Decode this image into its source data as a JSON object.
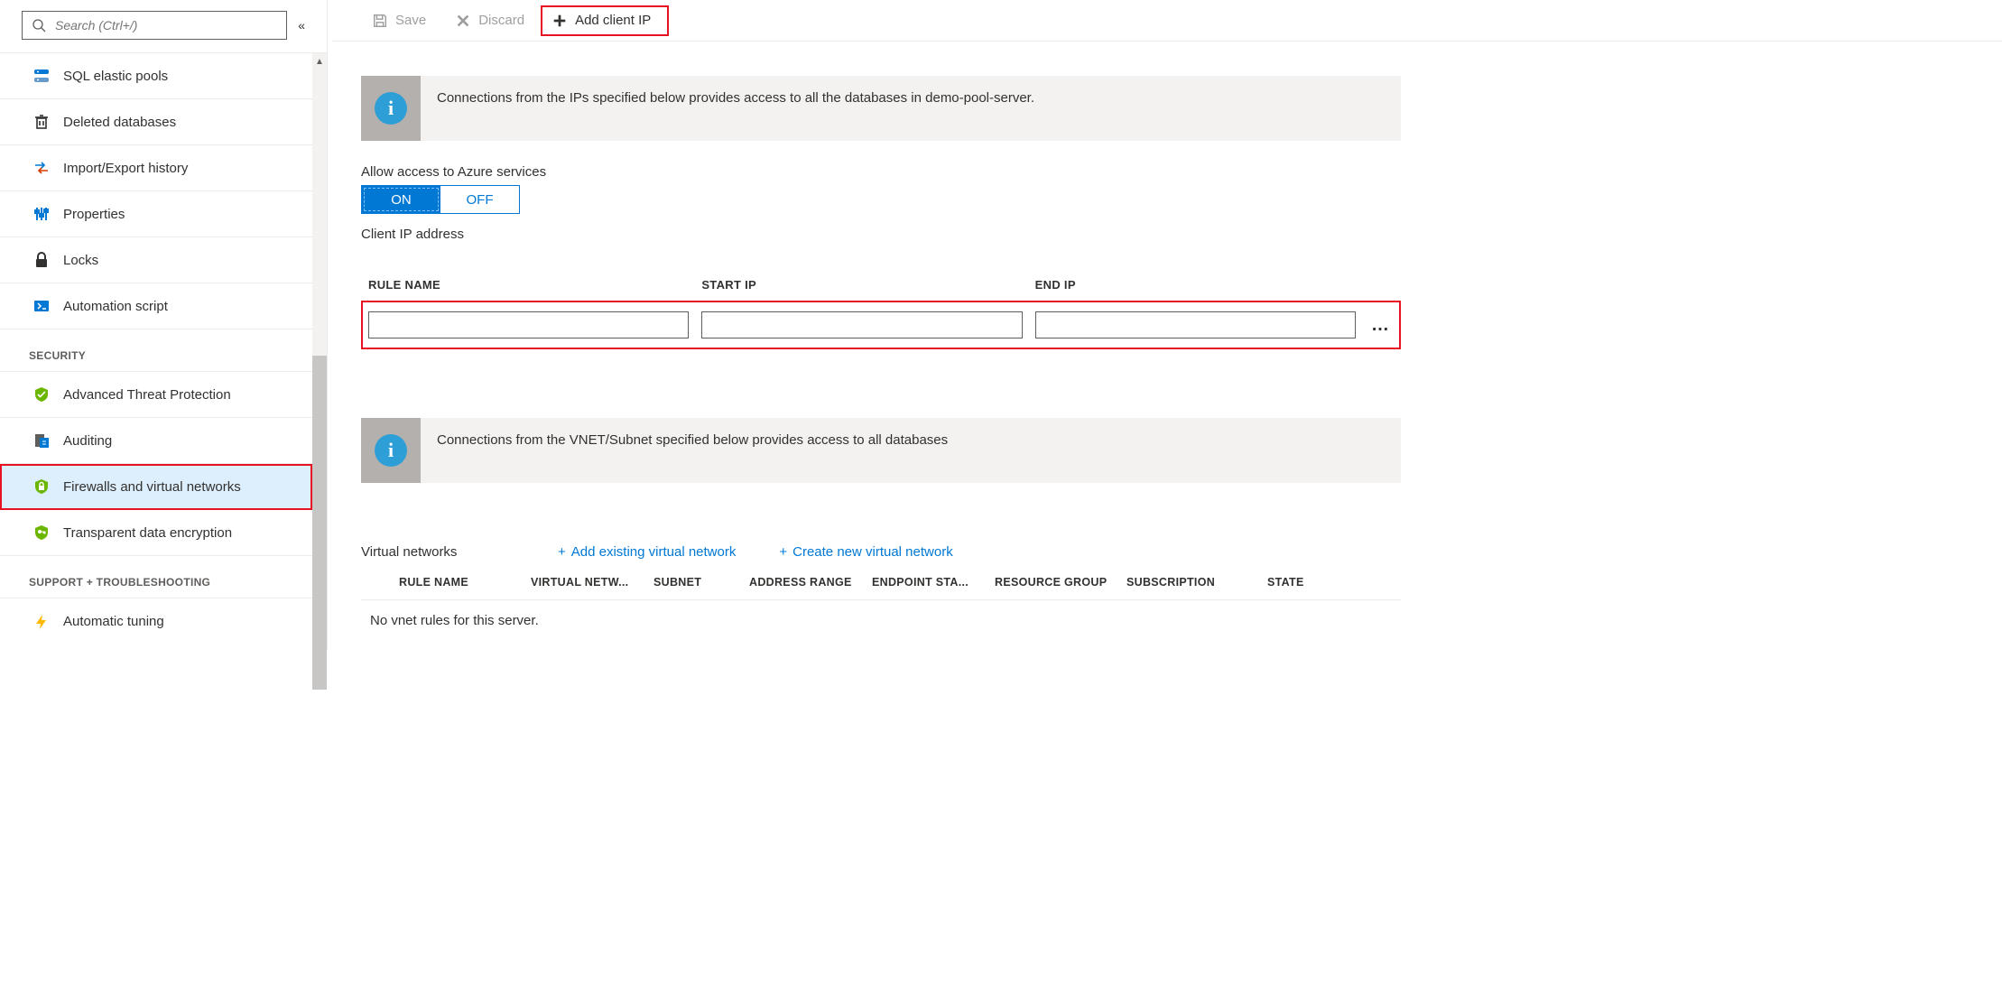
{
  "sidebar": {
    "search_placeholder": "Search (Ctrl+/)",
    "items": [
      {
        "label": "SQL elastic pools",
        "icon": "sql-pool"
      },
      {
        "label": "Deleted databases",
        "icon": "trash"
      },
      {
        "label": "Import/Export history",
        "icon": "import-export"
      },
      {
        "label": "Properties",
        "icon": "properties"
      },
      {
        "label": "Locks",
        "icon": "lock"
      },
      {
        "label": "Automation script",
        "icon": "automation"
      }
    ],
    "security_header": "SECURITY",
    "security_items": [
      {
        "label": "Advanced Threat Protection",
        "icon": "shield-check"
      },
      {
        "label": "Auditing",
        "icon": "auditing"
      },
      {
        "label": "Firewalls and virtual networks",
        "icon": "shield-lock",
        "selected": true,
        "highlight": true
      },
      {
        "label": "Transparent data encryption",
        "icon": "shield-key"
      }
    ],
    "support_header": "SUPPORT + TROUBLESHOOTING",
    "support_items": [
      {
        "label": "Automatic tuning",
        "icon": "bolt"
      }
    ]
  },
  "toolbar": {
    "save": "Save",
    "discard": "Discard",
    "add_client_ip": "Add client IP"
  },
  "info1": "Connections from the IPs specified below provides access to all the databases in demo-pool-server.",
  "allow_azure_label": "Allow access to Azure services",
  "toggle_on": "ON",
  "toggle_off": "OFF",
  "client_ip_label": "Client IP address",
  "fw_headers": {
    "rule_name": "RULE NAME",
    "start_ip": "START IP",
    "end_ip": "END IP"
  },
  "fw_row": {
    "rule_name": "",
    "start_ip": "",
    "end_ip": ""
  },
  "info2": "Connections from the VNET/Subnet specified below provides access to all databases",
  "vnet_label": "Virtual networks",
  "vnet_add_existing": "Add existing virtual network",
  "vnet_create_new": "Create new virtual network",
  "vnet_headers": {
    "rule_name": "RULE NAME",
    "virtual_network": "VIRTUAL NETW...",
    "subnet": "SUBNET",
    "address_range": "ADDRESS RANGE",
    "endpoint_status": "ENDPOINT STA...",
    "resource_group": "RESOURCE GROUP",
    "subscription": "SUBSCRIPTION",
    "state": "STATE"
  },
  "vnet_empty": "No vnet rules for this server."
}
